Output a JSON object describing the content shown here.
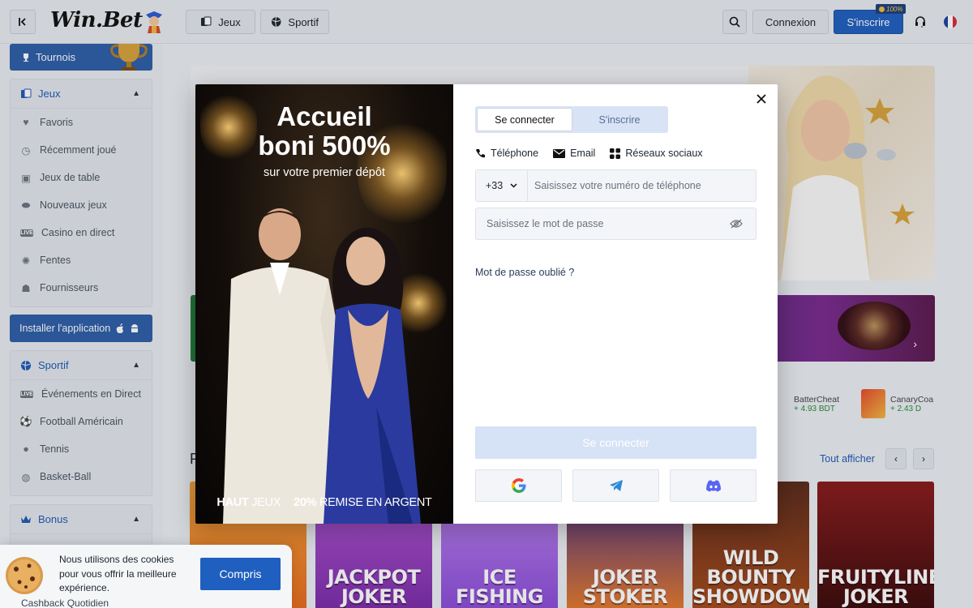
{
  "header": {
    "collapse_icon": "collapse-sidebar-icon",
    "logo": "Win.Bet",
    "nav": [
      {
        "label": "Jeux",
        "icon": "cards-icon"
      },
      {
        "label": "Sportif",
        "icon": "ball-icon"
      }
    ],
    "login_label": "Connexion",
    "signup_label": "S'inscrire",
    "signup_badge": "100%",
    "accent": "#1f5fbf"
  },
  "sidebar": {
    "tournois_label": "Tournois",
    "jeux": {
      "title": "Jeux",
      "items": [
        {
          "label": "Favoris",
          "icon": "heart-icon"
        },
        {
          "label": "Récemment joué",
          "icon": "history-icon"
        },
        {
          "label": "Jeux de table",
          "icon": "cards-icon"
        },
        {
          "label": "Nouveaux jeux",
          "icon": "new-icon"
        },
        {
          "label": "Casino en direct",
          "icon": "live-icon"
        },
        {
          "label": "Fentes",
          "icon": "slot-icon"
        },
        {
          "label": "Fournisseurs",
          "icon": "provider-icon"
        }
      ]
    },
    "install_label": "Installer l'application",
    "sportif": {
      "title": "Sportif",
      "items": [
        {
          "label": "Événements en Direct",
          "icon": "live-icon"
        },
        {
          "label": "Football Américain",
          "icon": "football-icon"
        },
        {
          "label": "Tennis",
          "icon": "tennis-icon"
        },
        {
          "label": "Basket-Ball",
          "icon": "basketball-icon"
        }
      ]
    },
    "bonus_title": "Bonus"
  },
  "main": {
    "winners": [
      {
        "name": "BatterCheat",
        "amount": "+ 4.93 BDT"
      },
      {
        "name": "CanaryCoa",
        "amount": "+ 2.43 D"
      }
    ],
    "section_title_initial": "P",
    "view_all": "Tout afficher",
    "games": [
      "JACKPOT JOKER",
      "ICE FISHING",
      "JOKER STOKER",
      "WILD BOUNTY SHOWDOWN",
      "FRUITYLINER JOKER"
    ]
  },
  "modal": {
    "promo": {
      "title_line1": "Accueil",
      "title_line2": "boni 500%",
      "subtitle": "sur votre premier dépôt",
      "footer_left_bold": "HAUT",
      "footer_left": "JEUX",
      "footer_right_bold": "20%",
      "footer_right": "REMISE EN ARGENT"
    },
    "tabs": [
      "Se connecter",
      "S'inscrire"
    ],
    "methods": [
      "Téléphone",
      "Email",
      "Réseaux sociaux"
    ],
    "phone_code": "+33",
    "phone_placeholder": "Saisissez votre numéro de téléphone",
    "password_placeholder": "Saisissez le mot de passe",
    "forgot": "Mot de passe oublié ?",
    "submit": "Se connecter"
  },
  "cookie": {
    "text": "Nous utilisons des cookies pour vous offrir la meilleure expérience.",
    "button": "Compris",
    "below_item": "Cashback Quotidien"
  }
}
